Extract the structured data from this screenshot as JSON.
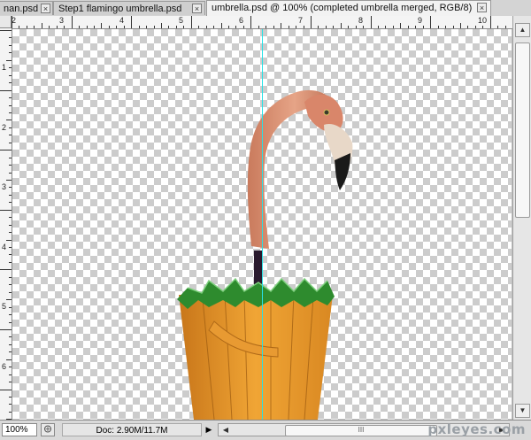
{
  "tabs": [
    {
      "label": "nan.psd",
      "close": "×"
    },
    {
      "label": "Step1 flamingo umbrella.psd",
      "close": "×"
    },
    {
      "label": "umbrella.psd @ 100% (completed umbrella merged, RGB/8)",
      "close": "×",
      "active": true
    }
  ],
  "ruler_top": {
    "labels": [
      "2",
      "3",
      "4",
      "5",
      "6",
      "7",
      "8",
      "9",
      "10"
    ]
  },
  "ruler_left": {
    "labels": [
      "1",
      "2",
      "3",
      "4",
      "5",
      "6"
    ]
  },
  "status": {
    "zoom": "100%",
    "doc": "Doc: 2.90M/11.7M",
    "doc_menu_arrow": "▶",
    "scroll_left": "◀",
    "scroll_right": "▶",
    "scroll_thumb_grip": "III"
  },
  "vscroll": {
    "up": "▲",
    "down": "▼"
  },
  "watermark": "pxleyes.com",
  "colors": {
    "guide": "#27e1e6",
    "umbrella_orange": "#e8941f",
    "umbrella_green": "#2a8a2a",
    "flamingo_pink": "#d98a6a"
  },
  "icons": {
    "close": "close-icon",
    "zoom_menu": "zoom-menu-icon"
  }
}
